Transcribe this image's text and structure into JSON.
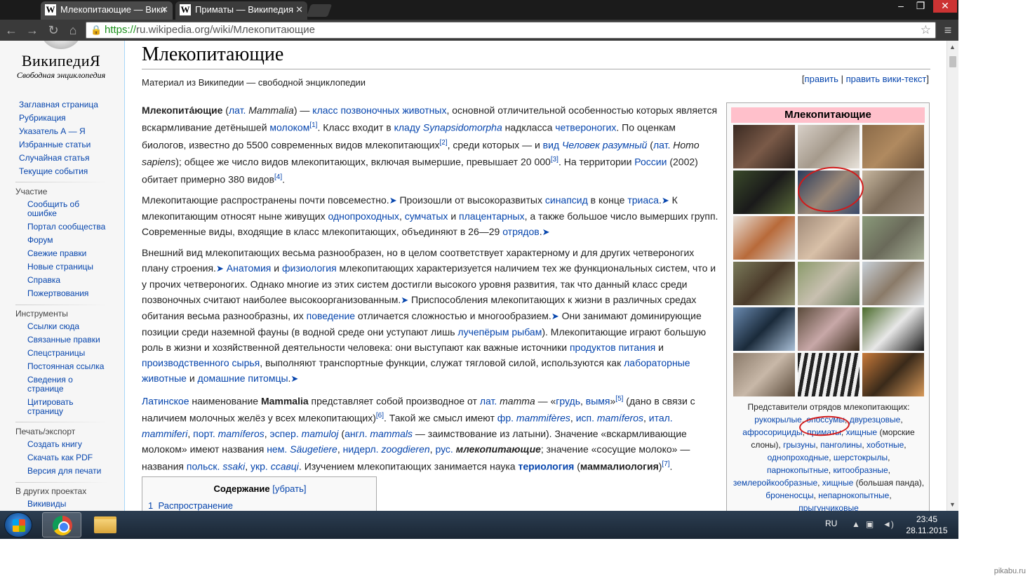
{
  "browser": {
    "tabs": [
      {
        "label": "Млекопитающие — Вики",
        "favicon": "W"
      },
      {
        "label": "Приматы — Википедия",
        "favicon": "W"
      }
    ],
    "window_buttons": [
      "–",
      "❐",
      "✕"
    ],
    "url_scheme": "https://",
    "url_rest": "ru.wikipedia.org/wiki/Млекопитающие"
  },
  "logo": {
    "wordmark": "ВикипедиЯ",
    "tagline": "Свободная энциклопедия"
  },
  "sidebar": {
    "main": [
      "Заглавная страница",
      "Рубрикация",
      "Указатель А — Я",
      "Избранные статьи",
      "Случайная статья",
      "Текущие события"
    ],
    "participation_head": "Участие",
    "participation": [
      "Сообщить об ошибке",
      "Портал сообщества",
      "Форум",
      "Свежие правки",
      "Новые страницы",
      "Справка",
      "Пожертвования"
    ],
    "tools_head": "Инструменты",
    "tools": [
      "Ссылки сюда",
      "Связанные правки",
      "Спецстраницы",
      "Постоянная ссылка",
      "Сведения о странице",
      "Цитировать страницу"
    ],
    "print_head": "Печать/экспорт",
    "print": [
      "Создать книгу",
      "Скачать как PDF",
      "Версия для печати"
    ],
    "projects_head": "В других проектах",
    "projects": [
      "Викивиды"
    ]
  },
  "article": {
    "title": "Млекопитающие",
    "site_sub": "Материал из Википедии — свободной энциклопедии",
    "edit": "править",
    "edit_wiki": "править вики-текст",
    "edit_sep": "|",
    "p1": {
      "b": "Млекопита́ющие",
      "t1": " (",
      "l1": "лат.",
      "t2": " ",
      "i1": "Mammalia",
      "t3": ") — ",
      "l2": "класс",
      "t4": " ",
      "l3": "позвоночных животных",
      "t5": ", основной отличительной особенностью которых является вскармливание детёнышей ",
      "l4": "молоком",
      "s1": "[1]",
      "t6": ". Класс входит в ",
      "l5": "кладу",
      "t7": " ",
      "li1": "Synapsidomorpha",
      "t8": " надкласса ",
      "l6": "четвероногих",
      "t9": ". По оценкам биологов, известно до 5500 современных видов млекопитающих",
      "s2": "[2]",
      "t10": ", среди которых — и ",
      "l7": "вид",
      "t11": " ",
      "li2": "Человек разумный",
      "t12": " (",
      "l8": "лат.",
      "t13": " ",
      "i2": "Homo sapiens",
      "t14": "); общее же число видов млекопитающих, включая вымершие, превышает 20 000",
      "s3": "[3]",
      "t15": ". На территории ",
      "l9": "России",
      "t16": " (2002) обитает примерно 380 видов",
      "s4": "[4]",
      "t17": "."
    },
    "p2": {
      "t1": "Млекопитающие распространены почти повсеместно.",
      "arrow": "➤",
      "t2": " Произошли от высокоразвитых ",
      "l1": "синапсид",
      "t3": " в конце ",
      "l2": "триаса",
      "t4": ".",
      "t5": " К млекопитающим относят ныне живущих ",
      "l3": "однопроходных",
      "t6": ", ",
      "l4": "сумчатых",
      "t7": " и ",
      "l5": "плацентарных",
      "t8": ", а также большое число вымерших групп. Современные виды, входящие в класс млекопитающих, объединяют в 26—29 ",
      "l6": "отрядов",
      "t9": "."
    },
    "p3": {
      "t1": "Внешний вид млекопитающих весьма разнообразен, но в целом соответствует характерному и для других четвероногих плану строения.",
      "t2": " ",
      "l1": "Анатомия",
      "t3": " и ",
      "l2": "физиология",
      "t4": " млекопитающих характеризуется наличием тех же функциональных систем, что и у прочих четвероногих. Однако многие из этих систем достигли высокого уровня развития, так что данный класс среди позвоночных считают наиболее высокоорганизованным.",
      "t5": " Приспособления млекопитающих к жизни в различных средах обитания весьма разнообразны, их ",
      "l3": "поведение",
      "t6": " отличается сложностью и многообразием.",
      "t7": " Они занимают доминирующие позиции среди наземной фауны (в водной среде они уступают лишь ",
      "l4": "лучепёрым рыбам",
      "t8": "). Млекопитающие играют большую роль в жизни и хозяйственной деятельности человека: они выступают как важные источники ",
      "l5": "продуктов питания",
      "t9": " и ",
      "l6": "производственного сырья",
      "t10": ", выполняют транспортные функции, служат тягловой силой, используются как ",
      "l7": "лабораторные животные",
      "t11": " и ",
      "l8": "домашние питомцы",
      "t12": "."
    },
    "p4": {
      "l1": "Латинское",
      "t1": " наименование ",
      "b1": "Mammalia",
      "t2": " представляет собой производное от ",
      "l2": "лат.",
      "t3": " ",
      "i1": "mamma",
      "t4": " — «",
      "l3": "грудь",
      "t5": ", ",
      "l4": "вымя",
      "t6": "»",
      "s1": "[5]",
      "t7": " (дано в связи с наличием молочных желёз у всех млекопитающих)",
      "s2": "[6]",
      "t8": ". Такой же смысл имеют ",
      "l5": "фр.",
      "t9": " ",
      "li1": "mammifères",
      "t10": ", ",
      "l6": "исп.",
      "t11": " ",
      "li2": "mamíferos",
      "t12": ", ",
      "l7": "итал.",
      "t13": " ",
      "li3": "mammiferi",
      "t14": ", ",
      "l8": "порт.",
      "t15": " ",
      "li4": "mamíferos",
      "t16": ", ",
      "l9": "эспер.",
      "t17": " ",
      "li5": "mamuloj",
      "t18": " (",
      "l10": "англ.",
      "t19": " ",
      "li6": "mammals",
      "t20": " — заимствование из латыни). Значение «вскармливающие молоком» имеют названия ",
      "l11": "нем.",
      "t21": " ",
      "li7": "Säugetiere",
      "t22": ", ",
      "l12": "нидерл.",
      "t23": " ",
      "li8": "zoogdieren",
      "t24": ", ",
      "l13": "рус.",
      "t25": " ",
      "bi1": "млекопитающие",
      "t26": "; значение «сосущие молоко» — названия ",
      "l14": "польск.",
      "t27": " ",
      "li9": "ssaki",
      "t28": ", ",
      "l15": "укр.",
      "t29": " ",
      "li10": "ссавці",
      "t30": ". Изучением млекопитающих занимается наука ",
      "lb1": "териология",
      "t31": " (",
      "b2": "маммалиология",
      "t32": ")",
      "s3": "[7]",
      "t33": "."
    },
    "toc": {
      "title": "Содержание",
      "toggle": "[убрать]",
      "item_num": "1",
      "item_label": "Распространение"
    }
  },
  "infobox": {
    "title": "Млекопитающие",
    "caption": {
      "t1": "Представители отрядов млекопитающих:",
      "l1": "рукокрылые",
      "l2": "опоссумы",
      "l3": "двурезцовые",
      "l4": "афросорициды",
      "l5": "приматы",
      "l6": "хищные",
      "t2": "(морские слоны),",
      "l7": "грызуны",
      "l8": "панголины",
      "l9": "хоботные",
      "l10": "однопроходные",
      "l11": "шерстокрылы",
      "l12": "парнокопытные",
      "l13": "китообразные",
      "l14": "землеройкообразные",
      "l15": "хищные",
      "t3": "(большая панда),",
      "l16": "броненосцы",
      "l17": "непарнокопытные",
      "l18": "прыгунчиковые"
    }
  },
  "taskbar": {
    "lang": "RU",
    "time": "23:45",
    "date": "28.11.2015"
  },
  "watermark": "pikabu.ru",
  "colors": {
    "link": "#0645ad",
    "annotation": "#d21a1a",
    "infobox_header": "#ffc0cb"
  }
}
